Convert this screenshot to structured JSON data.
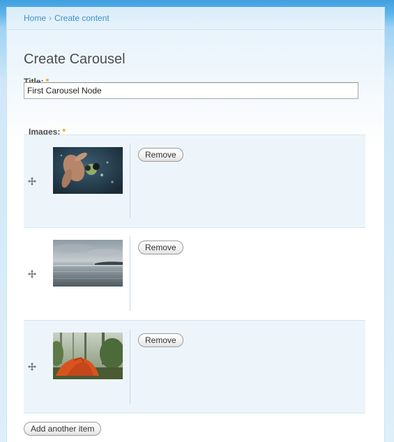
{
  "breadcrumb": {
    "home": "Home",
    "separator": "›",
    "current": "Create content"
  },
  "page_title": "Create Carousel",
  "title_field": {
    "label": "Title:",
    "required_mark": "*",
    "value": "First Carousel Node"
  },
  "images_field": {
    "label": "Images:",
    "required_mark": "*",
    "items": [
      {
        "remove_label": "Remove",
        "drag_icon": "drag-handle-icon"
      },
      {
        "remove_label": "Remove",
        "drag_icon": "drag-handle-icon"
      },
      {
        "remove_label": "Remove",
        "drag_icon": "drag-handle-icon"
      }
    ],
    "add_label": "Add another item"
  },
  "colors": {
    "link": "#3f8fce",
    "required": "#e8a500",
    "row_odd": "#edf5fb",
    "row_even": "#ffffff"
  }
}
